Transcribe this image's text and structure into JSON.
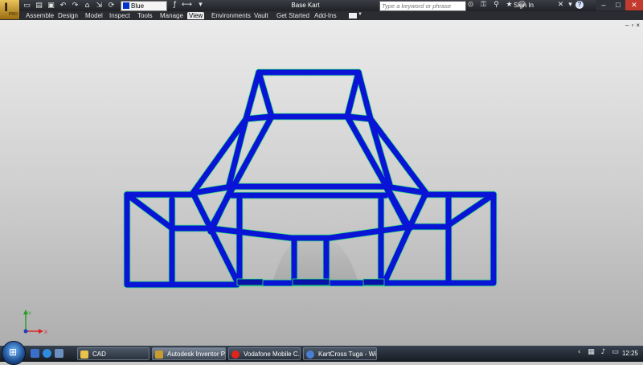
{
  "titlebar": {
    "document_title": "Base Kart",
    "color_style": "Blue",
    "search_placeholder": "Type a keyword or phrase",
    "sign_in": "Sign In",
    "help": "?",
    "minimize": "–",
    "maximize": "□",
    "close": "✕",
    "app_button_glyph": "I",
    "app_button_badge": "PRO"
  },
  "ribbon": {
    "tabs": [
      {
        "label": "Assemble"
      },
      {
        "label": "Design"
      },
      {
        "label": "Model"
      },
      {
        "label": "Inspect"
      },
      {
        "label": "Tools"
      },
      {
        "label": "Manage"
      },
      {
        "label": "View"
      },
      {
        "label": "Environments"
      },
      {
        "label": "Vault"
      },
      {
        "label": "Get Started"
      },
      {
        "label": "Add-Ins"
      }
    ],
    "active_tab": "View"
  },
  "viewport": {
    "frame_color": "#0a14d6",
    "edge_highlight_color": "#2ee37a",
    "background_top": "#ebebeb",
    "background_bottom": "#aeaeae",
    "axis": {
      "y_label": "Y",
      "x_label": "X"
    }
  },
  "taskbar": {
    "items": [
      {
        "label": "CAD",
        "icon": "folder-icon"
      },
      {
        "label": "Autodesk Inventor P...",
        "icon": "inventor-icon"
      },
      {
        "label": "Vodafone Mobile C...",
        "icon": "vodafone-icon"
      },
      {
        "label": "KartCross Tuga - Wi...",
        "icon": "browser-icon"
      }
    ],
    "clock": "12:25"
  }
}
